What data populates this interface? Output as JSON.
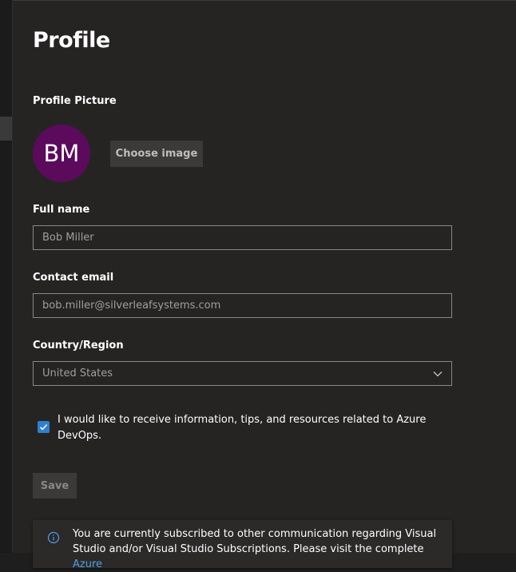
{
  "page": {
    "title": "Profile"
  },
  "profile_picture": {
    "label": "Profile Picture",
    "initials": "BM",
    "avatar_color": "#5c0a5c",
    "choose_label": "Choose image"
  },
  "full_name": {
    "label": "Full name",
    "value": "Bob Miller"
  },
  "contact_email": {
    "label": "Contact email",
    "value": "bob.miller@silverleafsystems.com"
  },
  "country": {
    "label": "Country/Region",
    "value": "United States",
    "icon": "chevron-down-icon"
  },
  "consent": {
    "checked": true,
    "text": "I would like to receive information, tips, and resources related to Azure DevOps.",
    "accent": "#2f7fd1"
  },
  "save_label": "Save",
  "notice": {
    "icon": "info-icon",
    "text": "You are currently subscribed to other communication regarding Visual Studio and/or Visual Studio Subscriptions. Please visit the complete",
    "link_text": "Azure"
  }
}
